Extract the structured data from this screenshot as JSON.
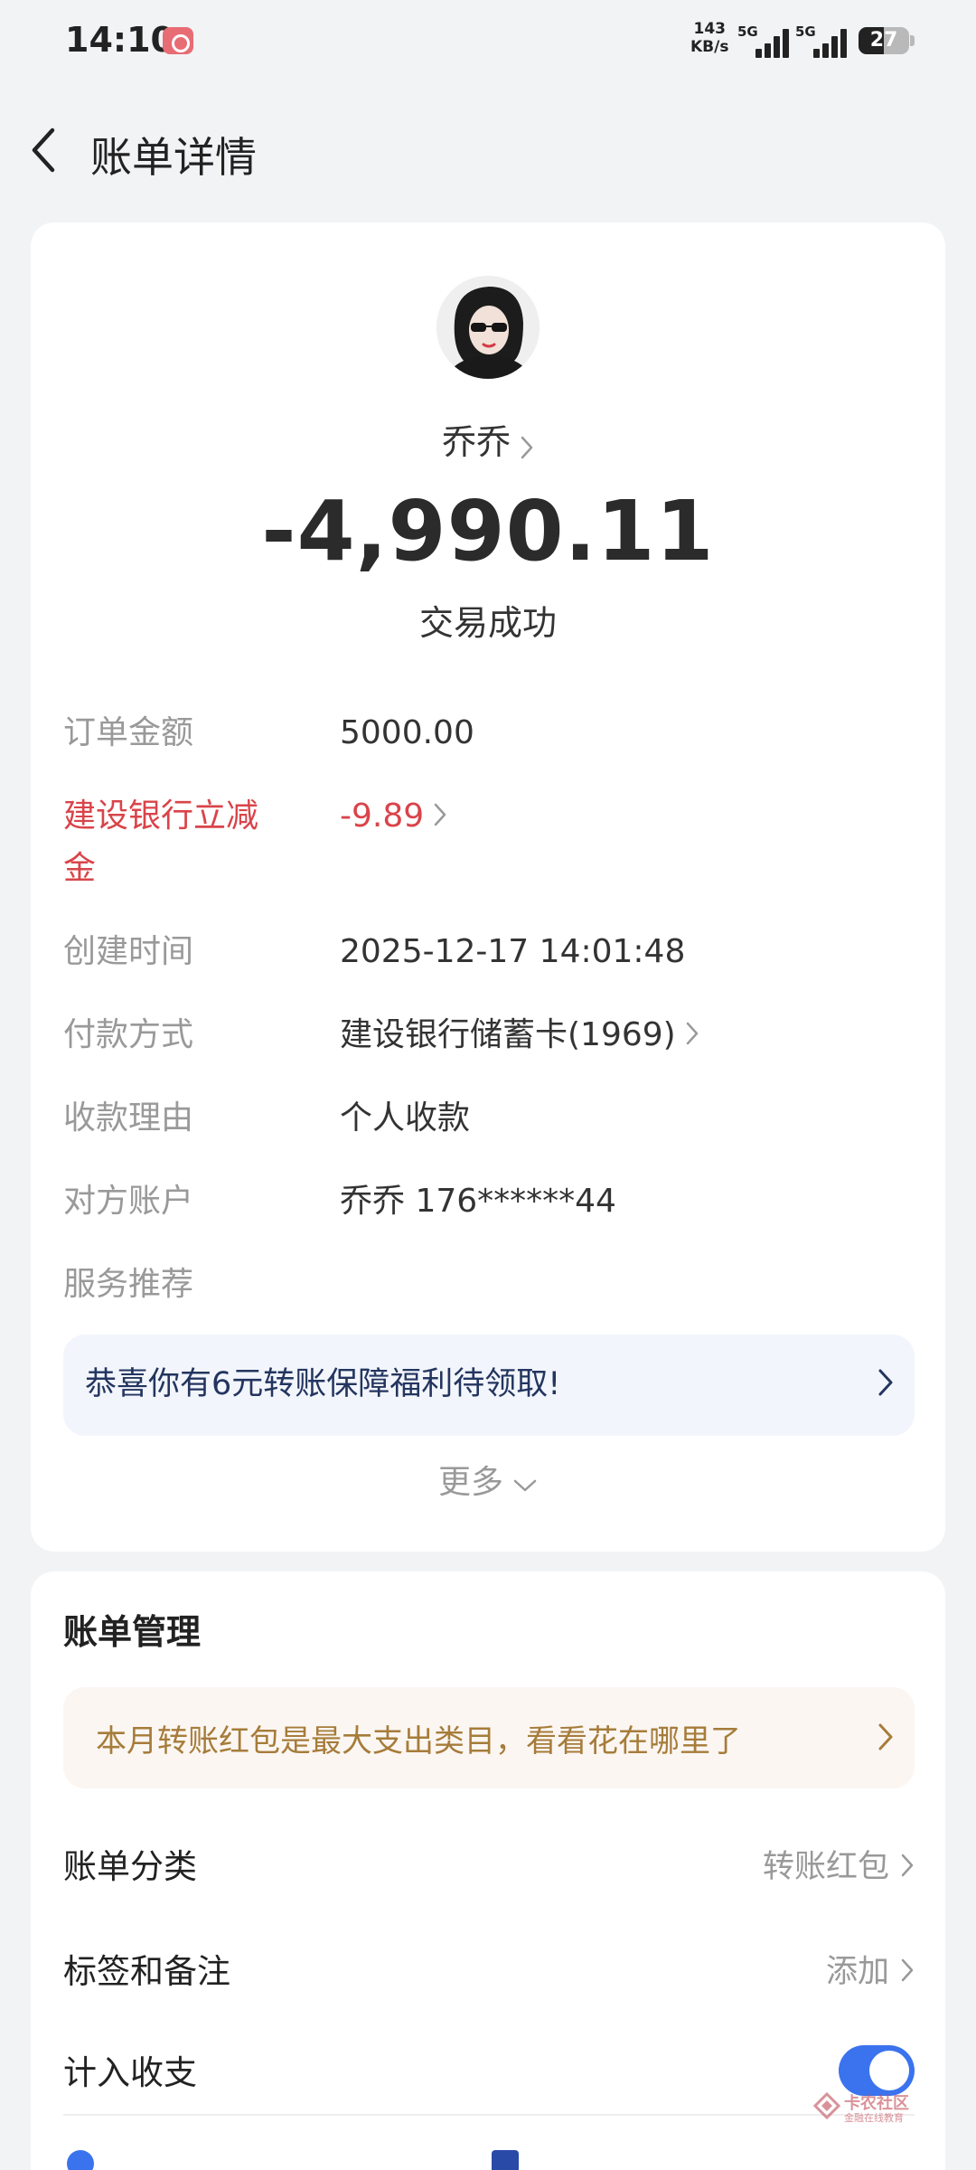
{
  "status_bar": {
    "time": "14:10",
    "net_speed_value": "143",
    "net_speed_unit": "KB/s",
    "signal1_label": "5G",
    "signal2_label": "5G",
    "battery": "27"
  },
  "header": {
    "title": "账单详情",
    "back_icon": "chevron-left-icon"
  },
  "transaction": {
    "payee": "乔乔",
    "amount": "-4,990.11",
    "status": "交易成功"
  },
  "details": [
    {
      "label": "订单金额",
      "value": "5000.00"
    },
    {
      "label": "建设银行立减金",
      "value": "-9.89"
    },
    {
      "label": "创建时间",
      "value": "2025-12-17 14:01:48"
    },
    {
      "label": "付款方式",
      "value": "建设银行储蓄卡(1969)"
    },
    {
      "label": "收款理由",
      "value": "个人收款"
    },
    {
      "label": "对方账户",
      "value": "乔乔 176******44"
    },
    {
      "label": "服务推荐",
      "value": ""
    }
  ],
  "promo": {
    "text": "恭喜你有6元转账保障福利待领取!"
  },
  "more_label": "更多",
  "management": {
    "title": "账单管理",
    "tip": "本月转账红包是最大支出类目，看看花在哪里了",
    "rows": [
      {
        "label": "账单分类",
        "value": "转账红包"
      },
      {
        "label": "标签和备注",
        "value": "添加"
      },
      {
        "label": "计入收支",
        "value": ""
      }
    ],
    "include_in_budget": true
  },
  "watermark": {
    "title": "卡农社区",
    "subtitle": "金融在线教育"
  },
  "colors": {
    "accent_blue": "#3b73ee",
    "discount_red": "#d9444a",
    "tip_gold": "#a67c3a",
    "promo_navy": "#23355f"
  }
}
